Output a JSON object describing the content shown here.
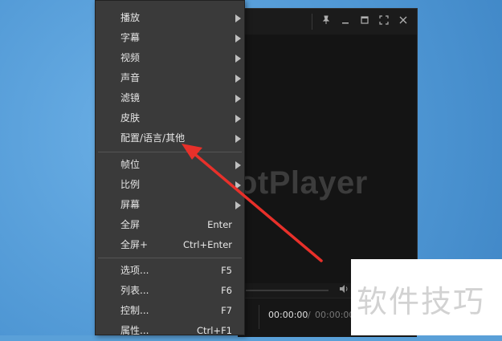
{
  "player": {
    "logo_text": "otPlayer",
    "time_current": "00:00:00",
    "time_separator": "/",
    "time_total": "00:00:00"
  },
  "titlebar_icons": [
    "pin-icon",
    "minimize-icon",
    "maximize-icon",
    "fullscreen-icon",
    "close-icon"
  ],
  "menu": {
    "group1": [
      {
        "label": "播放",
        "submenu": true
      },
      {
        "label": "字幕",
        "submenu": true
      },
      {
        "label": "视频",
        "submenu": true
      },
      {
        "label": "声音",
        "submenu": true
      },
      {
        "label": "滤镜",
        "submenu": true
      },
      {
        "label": "皮肤",
        "submenu": true
      },
      {
        "label": "配置/语言/其他",
        "submenu": true
      }
    ],
    "group2": [
      {
        "label": "帧位",
        "submenu": true
      },
      {
        "label": "比例",
        "submenu": true
      },
      {
        "label": "屏幕",
        "submenu": true
      },
      {
        "label": "全屏",
        "shortcut": "Enter"
      },
      {
        "label": "全屏+",
        "shortcut": "Ctrl+Enter"
      }
    ],
    "group3": [
      {
        "label": "选项...",
        "shortcut": "F5"
      },
      {
        "label": "列表...",
        "shortcut": "F6"
      },
      {
        "label": "控制...",
        "shortcut": "F7"
      },
      {
        "label": "属性...",
        "shortcut": "Ctrl+F1"
      }
    ]
  },
  "watermark": {
    "text": "软件技巧"
  },
  "colors": {
    "annotation": "#e8302a",
    "menu_bg": "#3a3a3a",
    "desktop": "#5aa0d8"
  }
}
